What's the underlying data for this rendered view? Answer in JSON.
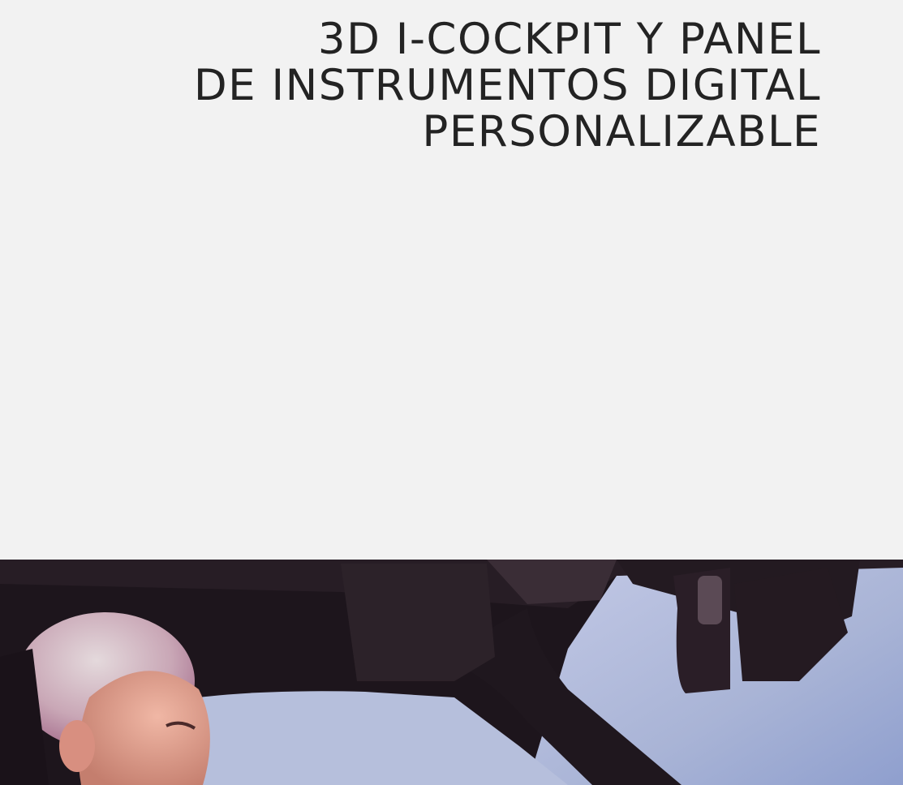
{
  "heading": {
    "lines": [
      "3D I-COCKPIT Y PANEL",
      "DE INSTRUMENTOS DIGITAL",
      "PERSONALIZABLE"
    ]
  },
  "media": {
    "photo_subject": "driver-in-car-interior"
  },
  "colors": {
    "page_background": "#f2f2f2",
    "heading_text": "#232323",
    "cabin_dark": "#1e161d",
    "sky": "#a9b4d6"
  }
}
